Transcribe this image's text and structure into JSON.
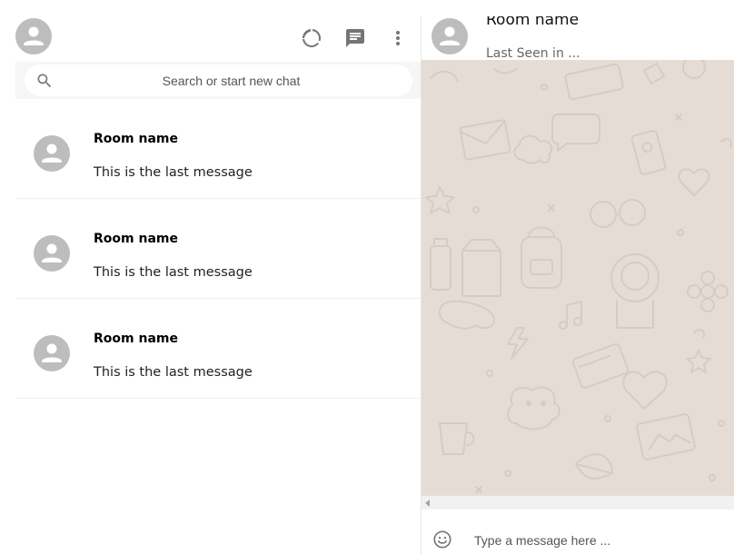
{
  "sidebar": {
    "header": {
      "icons": [
        "avatar-icon",
        "status-icon",
        "chat-icon",
        "more-vert-icon"
      ]
    },
    "search": {
      "placeholder": "Search or start new chat"
    },
    "chats": [
      {
        "name": "Room name",
        "last_message": "This is the last message"
      },
      {
        "name": "Room name",
        "last_message": "This is the last message"
      },
      {
        "name": "Room name",
        "last_message": "This is the last message"
      }
    ]
  },
  "chat": {
    "header": {
      "room_name": "Room name",
      "status": "Last Seen in ..."
    },
    "footer": {
      "placeholder": "Type a message here ...",
      "icons": [
        "emoji-icon"
      ]
    }
  },
  "colors": {
    "avatar_bg": "#bdbdbd",
    "icon_gray": "#757575",
    "chat_background": "#e5ddd5",
    "search_bar_bg": "#f6f6f6"
  }
}
